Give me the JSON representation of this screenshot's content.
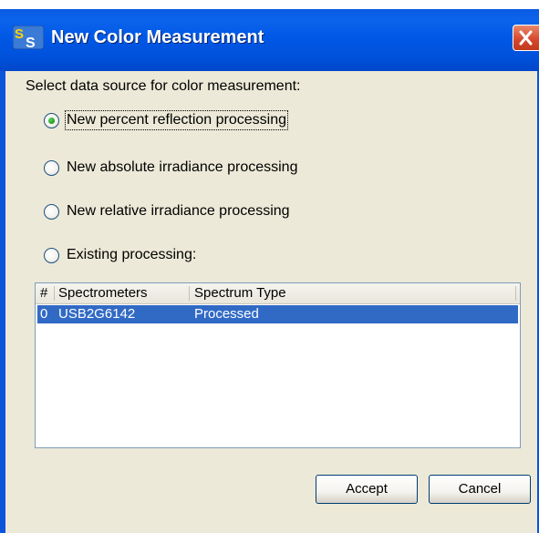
{
  "window": {
    "title": "New Color Measurement",
    "app_icon_text": "SS"
  },
  "prompt": "Select data source for color measurement:",
  "options": [
    {
      "label": "New percent reflection processing",
      "checked": true
    },
    {
      "label": "New absolute irradiance processing",
      "checked": false
    },
    {
      "label": "New relative irradiance processing",
      "checked": false
    },
    {
      "label": "Existing processing:",
      "checked": false
    }
  ],
  "table": {
    "columns": [
      "#",
      "Spectrometers",
      "Spectrum Type"
    ],
    "rows": [
      {
        "index": "0",
        "spectrometer": "USB2G6142",
        "spectrum_type": "Processed",
        "selected": true
      }
    ]
  },
  "buttons": {
    "accept": "Accept",
    "cancel": "Cancel"
  }
}
